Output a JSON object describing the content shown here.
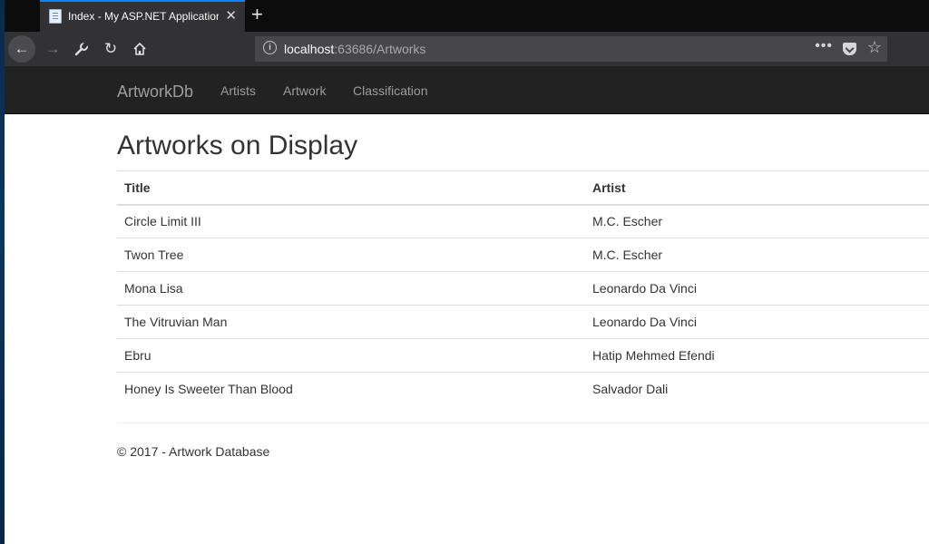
{
  "browser": {
    "tab_title": "Index - My ASP.NET Application",
    "url_host": "localhost",
    "url_rest": ":63686/Artworks"
  },
  "site": {
    "brand": "ArtworkDb",
    "nav": [
      "Artists",
      "Artwork",
      "Classification"
    ]
  },
  "page": {
    "title": "Artworks on Display",
    "columns": [
      "Title",
      "Artist"
    ],
    "rows": [
      [
        "Circle Limit III",
        "M.C. Escher"
      ],
      [
        "Twon Tree",
        "M.C. Escher"
      ],
      [
        "Mona Lisa",
        "Leonardo Da Vinci"
      ],
      [
        "The Vitruvian Man",
        "Leonardo Da Vinci"
      ],
      [
        "Ebru",
        "Hatip Mehmed Efendi"
      ],
      [
        "Honey Is Sweeter Than Blood",
        "Salvador Dali"
      ]
    ],
    "footer": "© 2017 - Artwork Database"
  },
  "icons": {
    "back": "back-arrow-icon",
    "forward": "forward-arrow-icon",
    "tools": "wrench-icon",
    "reload": "reload-icon",
    "home": "home-icon",
    "info": "info-icon",
    "more": "more-actions-icon",
    "pocket": "pocket-icon",
    "bookmark": "star-icon"
  },
  "colors": {
    "navbar_bg": "#222222",
    "nav_text": "#9d9d9d",
    "tab_accent": "#0a84ff"
  }
}
